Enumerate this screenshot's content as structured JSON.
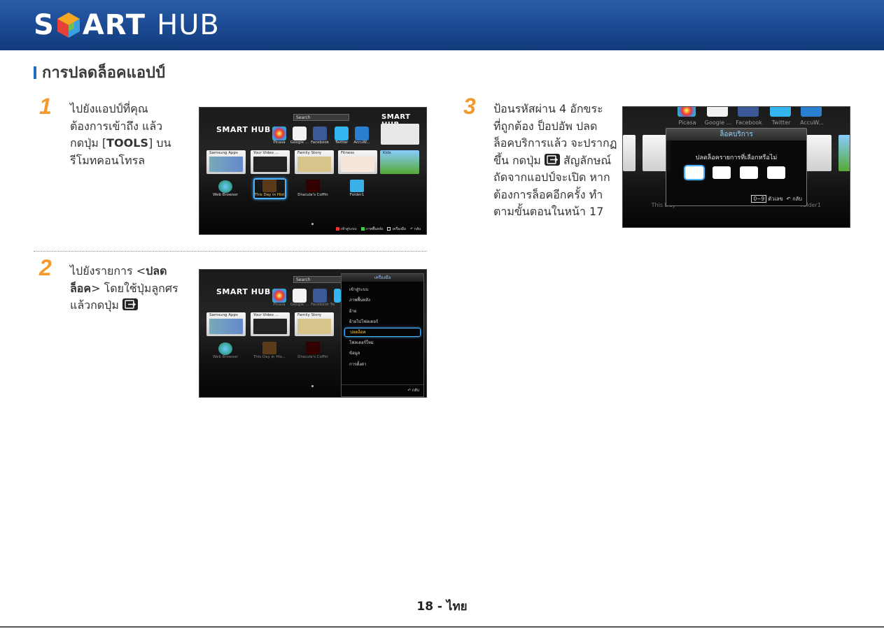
{
  "header": {
    "logo_s": "S",
    "logo_rt": "ART",
    "logo_hub": "HUB"
  },
  "section_title": "การปลดล็อคแอปป์",
  "steps": [
    {
      "number": "1",
      "lines": [
        "ไปยังแอปป์ที่คุณ",
        "ต้องการเข้าถึง แล้ว",
        "กดปุ่ม [",
        "TOOLS",
        "] บน",
        "รีโมทคอนโทรล"
      ]
    },
    {
      "number": "2",
      "lines": [
        "ไปยังรายการ <",
        "ปลด",
        "ล็อค",
        "> โดยใช้ปุ่มลูกศร",
        "แล้วกดปุ่ม"
      ]
    },
    {
      "number": "3",
      "lines": [
        "ป้อนรหัสผ่าน 4 อักขระ",
        "ที่ถูกต้อง ป็อปอัพ ปลด",
        "ล็อคบริการแล้ว จะปรากฏ",
        "ขึ้น กดปุ่ม",
        "สัญลักษณ์",
        "ถัดจากแอปป์จะเปิด หาก",
        "ต้องการล็อคอีกครั้ง ทำ",
        "ตามขั้นตอนในหน้า 17"
      ]
    }
  ],
  "tv1": {
    "logo": "SMART HUB",
    "hub_logo": "SMART HUB",
    "search": "Search",
    "apps": [
      "Picasa",
      "Google ...",
      "Facebook",
      "Twitter",
      "AccuW..."
    ],
    "tiles": [
      "Samsung Apps",
      "Your Video ...",
      "Family Story",
      "Fitness",
      "Kids"
    ],
    "bottom": [
      "Web Browser",
      "This Day in Hist",
      "Dracula's Coffin",
      "Folder1"
    ],
    "hints": [
      "เข้าสู่ระบบ",
      "ภาพพื้นหลัง",
      "เครื่องมือ",
      "กลับ"
    ]
  },
  "tv2": {
    "logo": "SMART HUB",
    "search": "Search",
    "apps": [
      "Picasa",
      "Google ...",
      "Facebook",
      "Tw"
    ],
    "tiles": [
      "Samsung Apps",
      "Your Video ...",
      "Family Story"
    ],
    "bottom": [
      "Web Browser",
      "This Day in His...",
      "Dracula's Coffin"
    ],
    "menu": {
      "title": "เครื่องมือ",
      "items": [
        "เข้าสู่ระบบ",
        "ภาพพื้นหลัง",
        "ย้าย",
        "ย้ายไปโฟลเดอร์",
        "ปลดล็อค",
        "โฟลเดอร์ใหม่",
        "ข้อมูล",
        "การตั้งค่า"
      ],
      "selected": "ปลดล็อค",
      "back": "กลับ"
    }
  },
  "tv3": {
    "apps": [
      "Picasa",
      "Google ...",
      "Facebook",
      "Twitter",
      "AccuW..."
    ],
    "dialog": {
      "title": "ล็อคบริการ",
      "message": "ปลดล็อครายการที่เลือกหรือไม่",
      "key": "0~9",
      "digits": "ตัวเลข",
      "back": "กลับ"
    },
    "bg_labels": [
      "This Day",
      "Folder1"
    ]
  },
  "footer": "18 - ไทย",
  "colors": {
    "banner": "#1b4a92",
    "accent_blue": "#1d6fc4",
    "step_orange": "#f29a2e"
  }
}
